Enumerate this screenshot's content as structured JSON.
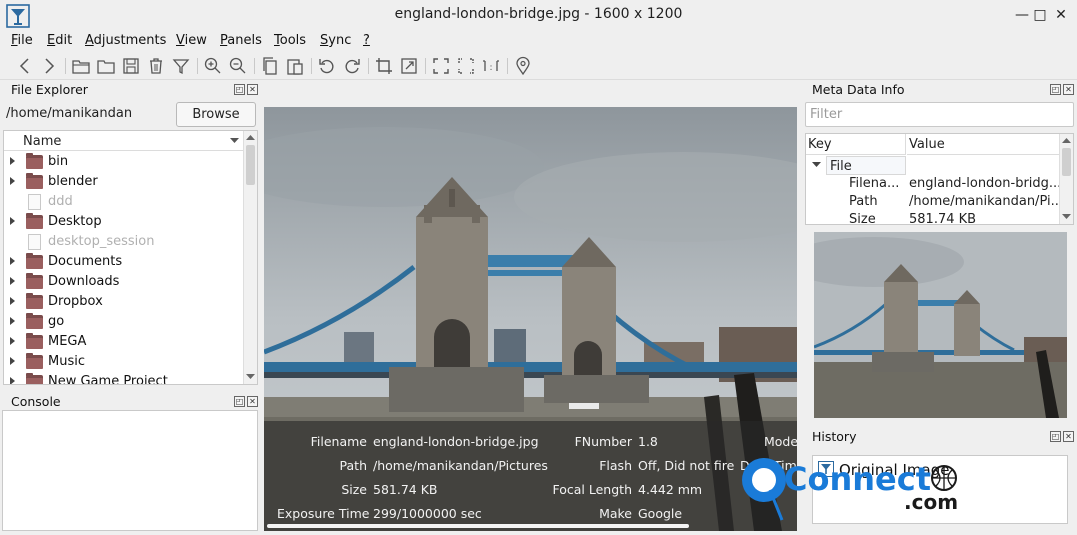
{
  "window": {
    "title": "england-london-bridge.jpg  - 1600 x 1200",
    "minimize": "—",
    "maximize": "□",
    "close": "✕"
  },
  "menu": [
    {
      "u": "F",
      "rest": "ile"
    },
    {
      "u": "E",
      "rest": "dit"
    },
    {
      "u": "A",
      "rest": "djustments"
    },
    {
      "u": "V",
      "rest": "iew"
    },
    {
      "u": "P",
      "rest": "anels"
    },
    {
      "u": "T",
      "rest": "ools"
    },
    {
      "u": "S",
      "rest": "ync"
    },
    {
      "u": "?",
      "rest": ""
    }
  ],
  "toolbar_icons": [
    "back-icon",
    "forward-icon",
    "open-folder-icon",
    "folder-icon",
    "save-icon",
    "delete-icon",
    "filter-icon",
    "zoom-in-icon",
    "zoom-out-icon",
    "copy-icon",
    "paste-icon",
    "rotate-left-icon",
    "rotate-right-icon",
    "crop-icon",
    "resize-icon",
    "fit-icon",
    "fit-width-icon",
    "actual-size-icon",
    "location-icon"
  ],
  "file_explorer": {
    "title": "File Explorer",
    "path": "/home/manikandan",
    "browse": "Browse",
    "column": "Name",
    "items": [
      {
        "name": "bin",
        "type": "folder"
      },
      {
        "name": "blender",
        "type": "folder"
      },
      {
        "name": "ddd",
        "type": "file"
      },
      {
        "name": "Desktop",
        "type": "folder"
      },
      {
        "name": "desktop_session",
        "type": "file"
      },
      {
        "name": "Documents",
        "type": "folder"
      },
      {
        "name": "Downloads",
        "type": "folder"
      },
      {
        "name": "Dropbox",
        "type": "folder"
      },
      {
        "name": "go",
        "type": "folder"
      },
      {
        "name": "MEGA",
        "type": "folder"
      },
      {
        "name": "Music",
        "type": "folder"
      },
      {
        "name": "New Game Project",
        "type": "folder"
      }
    ]
  },
  "console": {
    "title": "Console"
  },
  "exif": {
    "filename_k": "Filename",
    "filename_v": "england-london-bridge.jpg",
    "path_k": "Path",
    "path_v": "/home/manikandan/Pictures",
    "size_k": "Size",
    "size_v": "581.74 KB",
    "exposure_k": "Exposure Time",
    "exposure_v": "299/1000000 sec",
    "fnumber_k": "FNumber",
    "fnumber_v": "1.8",
    "flash_k": "Flash",
    "flash_v": "Off, Did not fire",
    "focal_k": "Focal Length",
    "focal_v": "4.442 mm",
    "make_k": "Make",
    "make_v": "Google",
    "model_k": "Mode",
    "date_k": "Date Tim"
  },
  "meta": {
    "title": "Meta Data Info",
    "filter_placeholder": "Filter",
    "col_key": "Key",
    "col_value": "Value",
    "group": "File",
    "rows": [
      {
        "k": "Filena...",
        "v": "england-london-bridg..."
      },
      {
        "k": "Path",
        "v": "/home/manikandan/Pi..."
      },
      {
        "k": "Size",
        "v": "581.74 KB"
      }
    ]
  },
  "history": {
    "title": "History",
    "items": [
      "Original Image"
    ]
  },
  "watermark": {
    "main": "Connect",
    "sub": ".com"
  },
  "colors": {
    "folder": "#9a5f5f",
    "accent": "#1a7bd8",
    "panel_bg": "#efefef"
  }
}
